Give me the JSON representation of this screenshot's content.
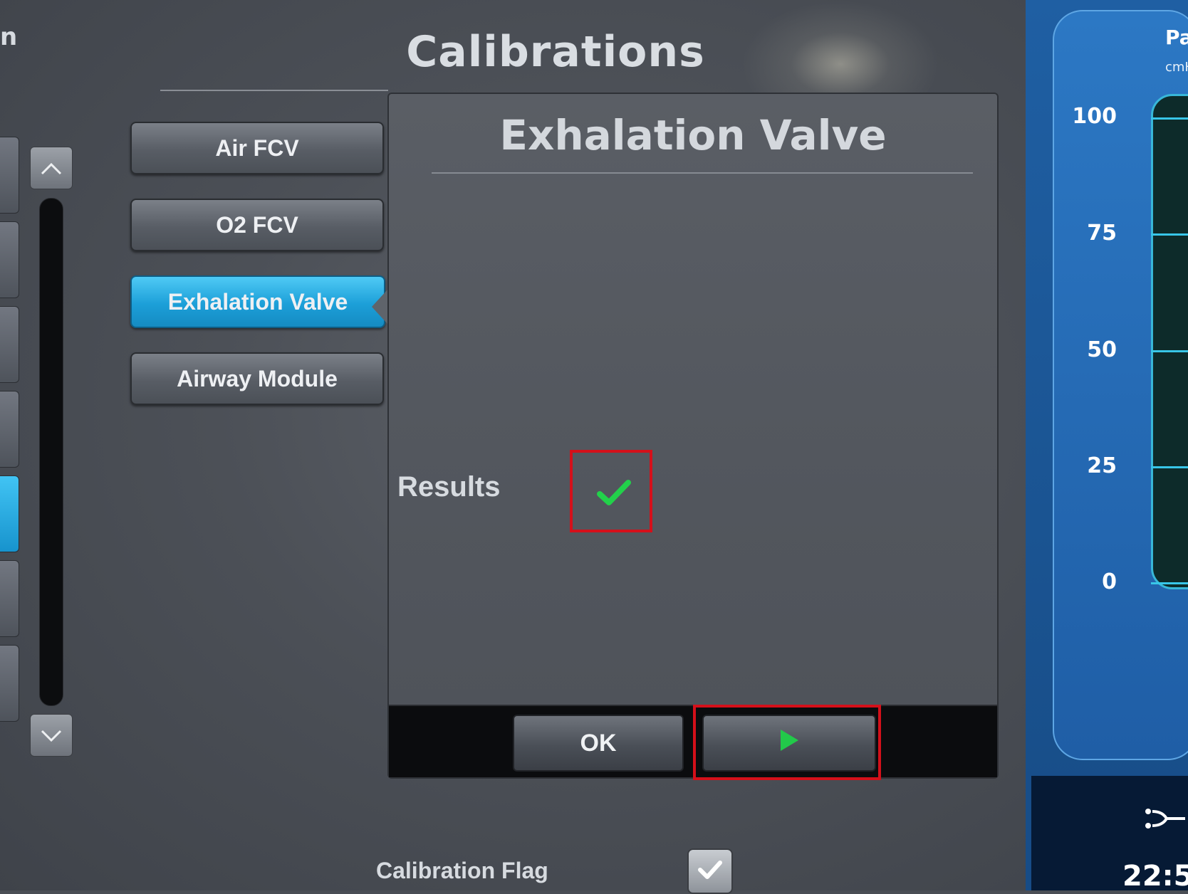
{
  "app": {
    "left_edge_text": "n",
    "title": "Calibrations"
  },
  "calibration_list": [
    {
      "label": "Air FCV",
      "active": false
    },
    {
      "label": "O2 FCV",
      "active": false
    },
    {
      "label": "Exhalation Valve",
      "active": true
    },
    {
      "label": "Airway Module",
      "active": false
    }
  ],
  "dialog": {
    "title": "Exhalation Valve",
    "results_label": "Results",
    "result_icon": "check-icon",
    "result_status": "pass",
    "ok_label": "OK",
    "start_icon": "play-icon"
  },
  "calibration_flag": {
    "label": "Calibration Flag",
    "checked": true
  },
  "waveform": {
    "title": "Pa",
    "unit": "cmH",
    "axis_ticks": [
      "100",
      "75",
      "50",
      "25",
      "0"
    ]
  },
  "status_bar": {
    "time": "22:5"
  },
  "colors": {
    "accent_blue": "#1c9fd8",
    "check_green": "#22d14a",
    "annotation_red": "#d4101a",
    "waveform_blue": "#1f5ea6"
  }
}
